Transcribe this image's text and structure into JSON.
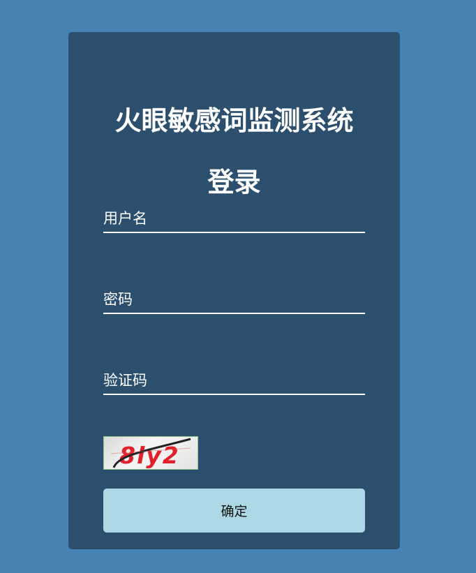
{
  "app": {
    "title": "火眼敏感词监测系统",
    "login_heading": "登录"
  },
  "form": {
    "username_placeholder": "用户名",
    "password_placeholder": "密码",
    "captcha_placeholder": "验证码",
    "captcha_text": "8ly2",
    "submit_label": "确定"
  },
  "colors": {
    "page_background": "#4682b4",
    "card_background": "#2c4f6e",
    "button_background": "#add8e6",
    "captcha_text": "#e0202a",
    "text": "#ffffff"
  }
}
